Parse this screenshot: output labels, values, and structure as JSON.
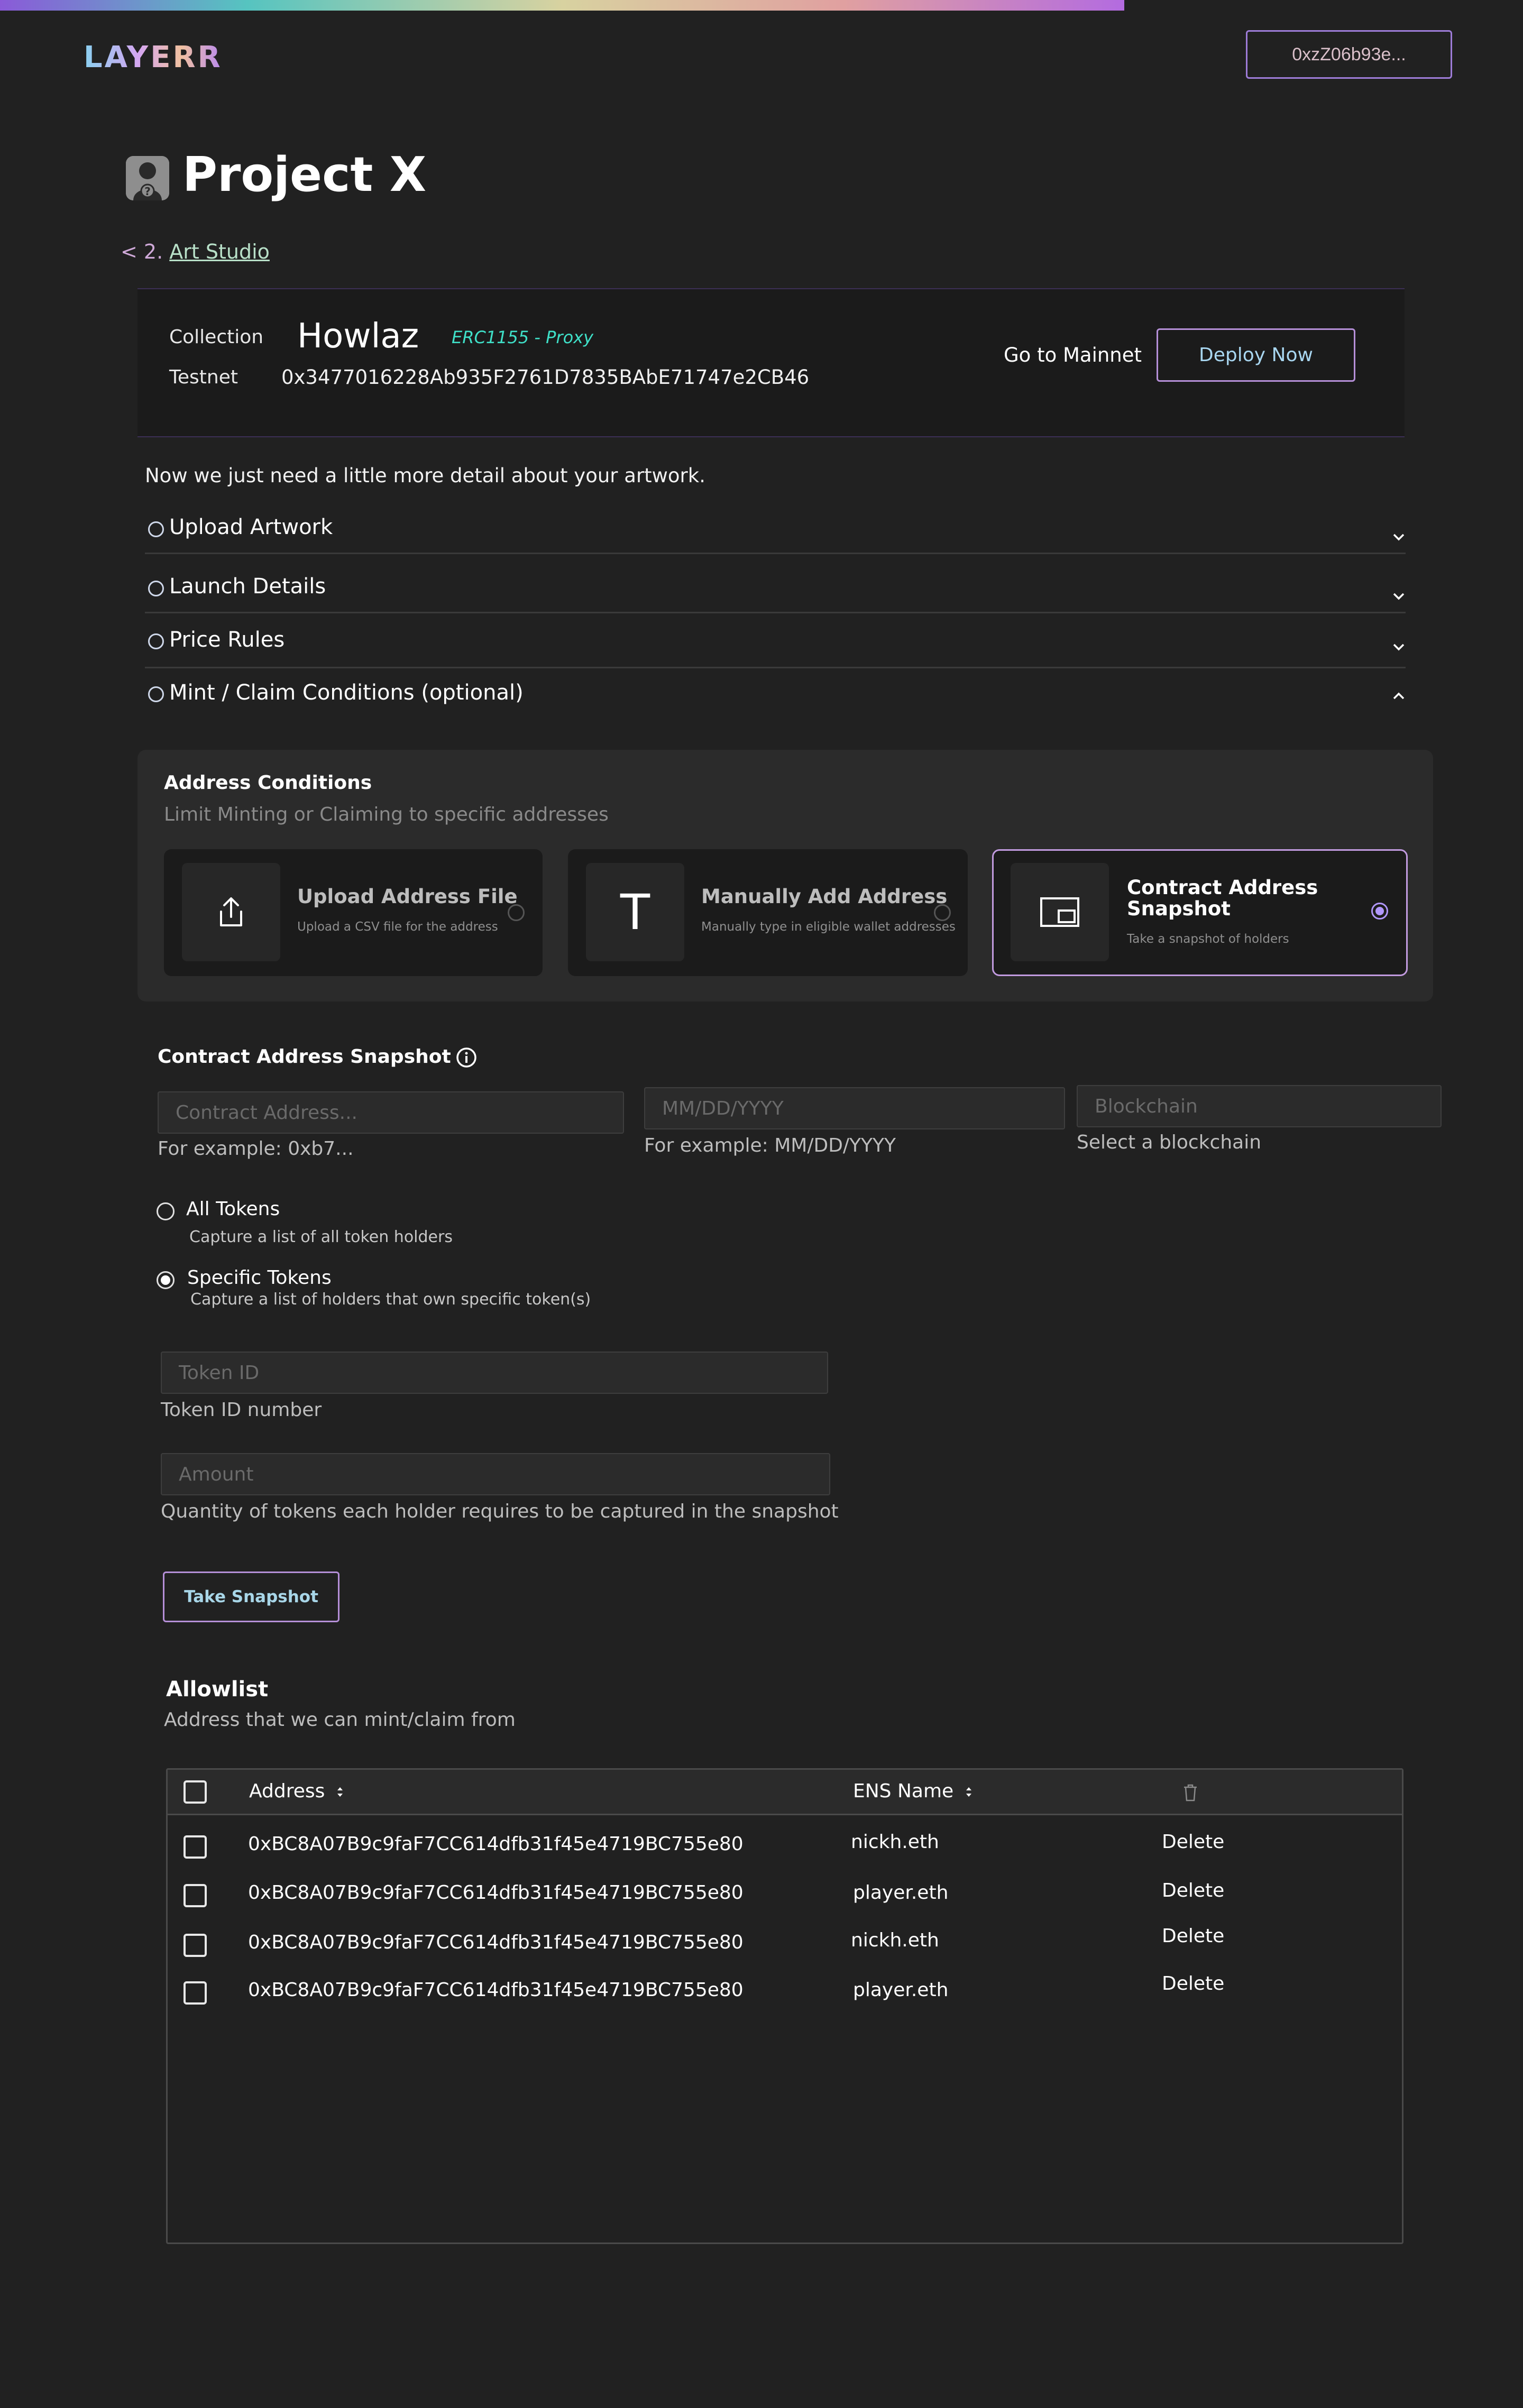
{
  "header": {
    "logo": "LAYERR",
    "wallet": "0xzZ06b93e..."
  },
  "project": {
    "title": "Project X",
    "breadcrumb_prefix": "< 2.",
    "breadcrumb_link": "Art Studio"
  },
  "collection": {
    "collection_label": "Collection",
    "name": "Howlaz",
    "standard": "ERC1155 - Proxy",
    "network_label": "Testnet",
    "address": "0x3477016228Ab935F2761D7835BAbE71747e2CB46",
    "go_mainnet": "Go to Mainnet",
    "deploy": "Deploy Now"
  },
  "intro": "Now we just need a little more detail about your artwork.",
  "sections": [
    {
      "label": "Upload Artwork",
      "state": "collapsed"
    },
    {
      "label": "Launch Details",
      "state": "collapsed"
    },
    {
      "label": "Price Rules",
      "state": "collapsed"
    },
    {
      "label": "Mint / Claim Conditions (optional)",
      "state": "expanded"
    }
  ],
  "address_conditions": {
    "title": "Address Conditions",
    "subtitle": "Limit Minting or Claiming to specific addresses",
    "cards": [
      {
        "title": "Upload Address File",
        "subtitle": "Upload a CSV file for the address",
        "icon": "upload-icon",
        "selected": false
      },
      {
        "title": "Manually Add Address",
        "subtitle": "Manually type in eligible wallet addresses",
        "icon": "text-T-icon",
        "selected": false
      },
      {
        "title": "Contract Address",
        "title2": "Snapshot",
        "subtitle": "Take a snapshot of holders",
        "icon": "snapshot-window-icon",
        "selected": true
      }
    ]
  },
  "snapshot": {
    "title": "Contract Address Snapshot",
    "contract_placeholder": "Contract Address...",
    "contract_help": "For example: 0xb7...",
    "date_placeholder": "MM/DD/YYYY",
    "date_help": "For example: MM/DD/YYYY",
    "chain_placeholder": "Blockchain",
    "chain_help": "Select a blockchain",
    "options": [
      {
        "label": "All Tokens",
        "desc": "Capture a list of all token holders",
        "selected": false
      },
      {
        "label": "Specific Tokens",
        "desc": "Capture a list of holders that own specific token(s)",
        "selected": true
      }
    ],
    "token_placeholder": "Token ID",
    "token_help": "Token ID number",
    "amount_placeholder": "Amount",
    "amount_help": "Quantity of tokens each holder requires to be captured in the snapshot",
    "button": "Take Snapshot"
  },
  "allowlist": {
    "title": "Allowlist",
    "subtitle": "Address that we can mint/claim from",
    "col_address": "Address",
    "col_ens": "ENS Name",
    "rows": [
      {
        "address": "0xBC8A07B9c9faF7CC614dfb31f45e4719BC755e80",
        "ens": "nickh.eth",
        "action": "Delete"
      },
      {
        "address": "0xBC8A07B9c9faF7CC614dfb31f45e4719BC755e80",
        "ens": "player.eth",
        "action": "Delete"
      },
      {
        "address": "0xBC8A07B9c9faF7CC614dfb31f45e4719BC755e80",
        "ens": "nickh.eth",
        "action": "Delete"
      },
      {
        "address": "0xBC8A07B9c9faF7CC614dfb31f45e4719BC755e80",
        "ens": "player.eth",
        "action": "Delete"
      }
    ]
  }
}
